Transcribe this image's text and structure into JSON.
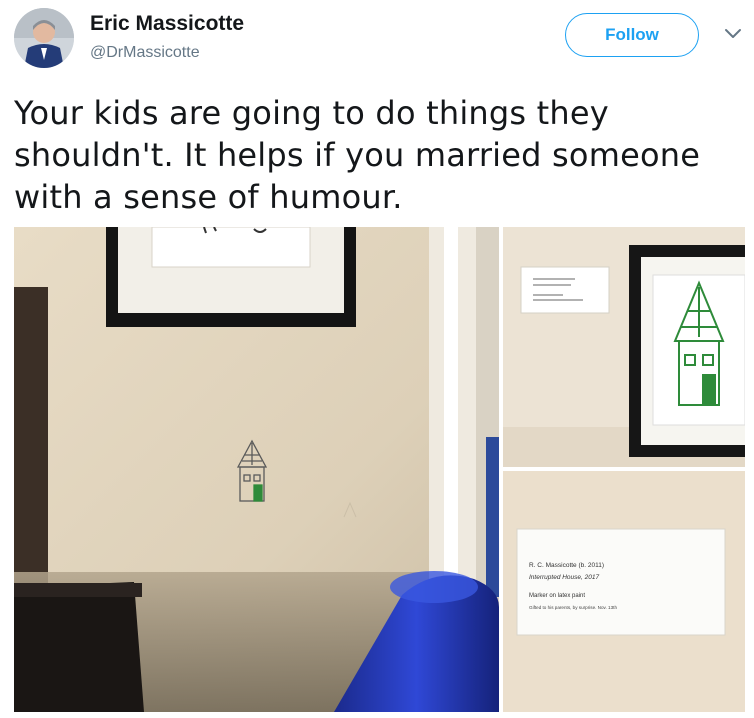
{
  "author": {
    "name": "Eric Massicotte",
    "handle": "@DrMassicotte",
    "avatar_icon": "user-avatar"
  },
  "actions": {
    "follow_label": "Follow",
    "more_icon": "chevron-down-icon"
  },
  "tweet": {
    "lines": [
      "Your kids are going to do things they",
      "shouldn't. It helps if you married someone",
      "with a sense of humour."
    ]
  },
  "museum_label": {
    "artist": "R. C. Massicotte (b. 2011)",
    "title": "Interrupted House, 2017",
    "medium": "Marker on latex paint",
    "credit": "Gifted to his parents, by surprise. Nov. 13th"
  },
  "colors": {
    "follow_blue": "#1da1f2",
    "handle_gray": "#657786",
    "text": "#14171a",
    "drawing_green": "#2e8b3a"
  }
}
